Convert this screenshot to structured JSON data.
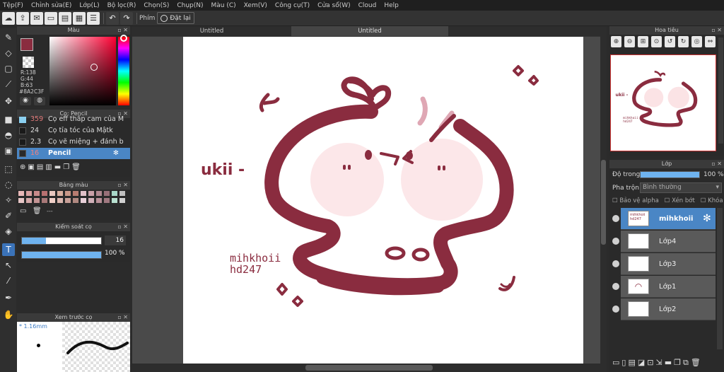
{
  "menu": [
    "Tệp(F)",
    "Chỉnh sửa(E)",
    "Lớp(L)",
    "Bộ lọc(R)",
    "Chọn(S)",
    "Chụp(N)",
    "Màu (C)",
    "Xem(V)",
    "Công cụ(T)",
    "Cửa sổ(W)",
    "Cloud",
    "Help"
  ],
  "toolbar": {
    "shortcut_label": "Phím",
    "redo_label": "Đặt lại"
  },
  "color_panel": {
    "title": "Màu",
    "r": "R:138",
    "g": "G:44",
    "b": "B:63",
    "hex": "#8A2C3F",
    "accent": "#8a2c3f"
  },
  "brush_panel": {
    "title": "Cọ: Pencil",
    "items": [
      {
        "size": "359",
        "name": "Cọ eff thấp cam của M"
      },
      {
        "size": "24",
        "name": "Cọ tỉa tóc của Mậtk"
      },
      {
        "size": "2.3",
        "name": "Cọ vẽ miệng + đánh b"
      },
      {
        "size": "16",
        "name": "Pencil"
      }
    ]
  },
  "palette_panel": {
    "title": "Bảng màu",
    "dash": "---"
  },
  "brush_control": {
    "title": "Kiểm soát cọ",
    "size": "16",
    "opacity": "100 %",
    "size_fraction": 0.3,
    "opacity_fraction": 1.0
  },
  "preview_panel": {
    "title": "Xem trước cọ",
    "size": "* 1.16mm"
  },
  "tabs": [
    "Untitled",
    "Untitled"
  ],
  "artwork": {
    "name": "ukii -",
    "signature1": "mihkhoii",
    "signature2": "hd247"
  },
  "navigator": {
    "title": "Hoa tiêu",
    "name": "ukii -",
    "signature1": "mihkhoii",
    "signature2": "hd247"
  },
  "layer_panel": {
    "title": "Lớp",
    "opacity_label": "Độ trong",
    "opacity_value": "100 %",
    "blend_label": "Pha trộn",
    "blend_value": "Bình thường",
    "protect_alpha": "Bảo vệ alpha",
    "clip": "Xén bớt",
    "lock": "Khóa",
    "layers": [
      {
        "name": "mihkhoii",
        "thumb": "mihkhoii hd247"
      },
      {
        "name": "Lớp4"
      },
      {
        "name": "Lớp3"
      },
      {
        "name": "Lớp1"
      },
      {
        "name": "Lớp2"
      }
    ]
  }
}
